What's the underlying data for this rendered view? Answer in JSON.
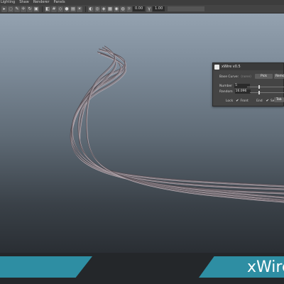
{
  "menubar": {
    "items": [
      "Lighting",
      "Shaw",
      "Renderer",
      "Panels"
    ]
  },
  "toolbar": {
    "value_a": "0.00",
    "value_b": "1.00"
  },
  "panel": {
    "title": "xWire v0.5",
    "base_curve_label": "Base Curve:",
    "base_curve_value": "(none)",
    "pick_label": "Pick",
    "remove_label": "Remov",
    "number_label": "Number",
    "number_value": "5",
    "number_level": 0.3,
    "random_label": "Random",
    "random_value": "16.096",
    "random_level": 0.25,
    "lock_label": "Lock",
    "front_label": "Front",
    "end_label": "End",
    "sweep_label": "Sweep",
    "tab_label": "Tab"
  },
  "brand": {
    "title": "xWire"
  },
  "colors": {
    "accent": "#2e8ea3",
    "wire": "#8a7f86"
  }
}
